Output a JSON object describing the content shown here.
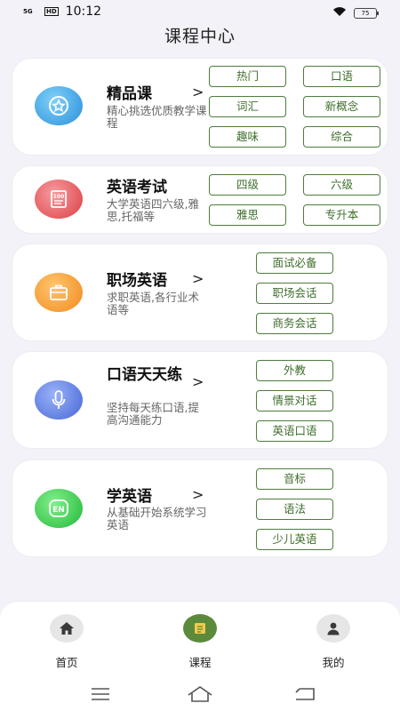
{
  "status_bar": {
    "signal": "5G",
    "hd": "HD",
    "time": "10:12",
    "battery": "75"
  },
  "page_title": "课程中心",
  "cards": [
    {
      "title": "精品课",
      "desc": "精心挑选优质教学课程",
      "icon": "star-icon",
      "icon_color": "#3ea6e8",
      "tags": [
        "热门",
        "口语",
        "词汇",
        "新概念",
        "趣味",
        "综合"
      ]
    },
    {
      "title": "英语考试",
      "desc": "大学英语四六级,雅思,托福等",
      "icon": "certificate-icon",
      "icon_color": "#e8595e",
      "tags": [
        "四级",
        "六级",
        "雅思",
        "专升本"
      ]
    },
    {
      "title": "职场英语",
      "desc": "求职英语,各行业术语等",
      "icon": "briefcase-icon",
      "icon_color": "#f4a23a",
      "tags": [
        "面试必备",
        "职场会话",
        "商务会话"
      ]
    },
    {
      "title": "口语天天练",
      "desc": "坚持每天练口语,提高沟通能力",
      "icon": "microphone-icon",
      "icon_color": "#5b7fe6",
      "tags": [
        "外教",
        "情景对话",
        "英语口语"
      ]
    },
    {
      "title": "学英语",
      "desc": "从基础开始系统学习英语",
      "icon": "en-icon",
      "icon_color": "#3ed04e",
      "tags": [
        "音标",
        "语法",
        "少儿英语"
      ]
    }
  ],
  "bottom_nav": [
    {
      "label": "首页",
      "icon": "home-icon",
      "active": false
    },
    {
      "label": "课程",
      "icon": "book-icon",
      "active": true
    },
    {
      "label": "我的",
      "icon": "user-icon",
      "active": false
    }
  ],
  "colors": {
    "accent": "#5c8a3c",
    "tag_border": "#4d7d3c",
    "background": "#f3f2f8"
  }
}
